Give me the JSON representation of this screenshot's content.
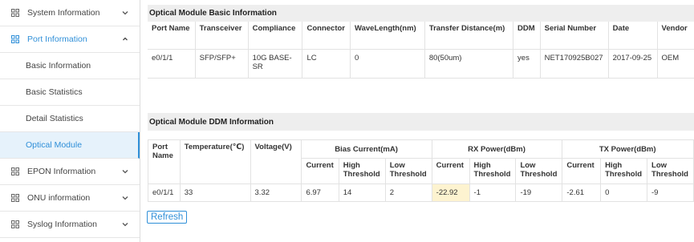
{
  "sidebar": {
    "items": [
      {
        "label": "System Information",
        "icon": "grid-icon",
        "expanded": false
      },
      {
        "label": "Port Information",
        "icon": "grid-icon",
        "expanded": true,
        "children": [
          {
            "label": "Basic Information"
          },
          {
            "label": "Basic Statistics"
          },
          {
            "label": "Detail Statistics"
          },
          {
            "label": "Optical Module",
            "selected": true
          }
        ]
      },
      {
        "label": "EPON Information",
        "icon": "grid-icon",
        "expanded": false
      },
      {
        "label": "ONU information",
        "icon": "grid-icon",
        "expanded": false
      },
      {
        "label": "Syslog Information",
        "icon": "grid-icon",
        "expanded": false
      }
    ]
  },
  "basic": {
    "title": "Optical Module Basic Information",
    "headers": [
      "Port Name",
      "Transceiver",
      "Compliance",
      "Connector",
      "WaveLength(nm)",
      "Transfer Distance(m)",
      "DDM",
      "Serial Number",
      "Date",
      "Vendor"
    ],
    "row": [
      "e0/1/1",
      "SFP/SFP+",
      "10G BASE-SR",
      "LC",
      "0",
      "80(50um)",
      "yes",
      "NET170925B027",
      "2017-09-25",
      "OEM"
    ]
  },
  "ddm": {
    "title": "Optical Module DDM Information",
    "headers": {
      "port": "Port Name",
      "temperature": "Temperature(℃)",
      "voltage": "Voltage(V)",
      "bias": "Bias Current(mA)",
      "rx": "RX Power(dBm)",
      "tx": "TX Power(dBm)",
      "current": "Current",
      "high": "High Threshold",
      "low": "Low Threshold"
    },
    "row": {
      "port": "e0/1/1",
      "temperature": "33",
      "voltage": "3.32",
      "bias_current": "6.97",
      "bias_high": "14",
      "bias_low": "2",
      "rx_current": "-22.92",
      "rx_high": "-1",
      "rx_low": "-19",
      "tx_current": "-2.61",
      "tx_high": "0",
      "tx_low": "-9"
    },
    "highlight_color": "#fdf3d0"
  },
  "refresh_label": "Refresh",
  "accent_color": "#2f8fd8"
}
